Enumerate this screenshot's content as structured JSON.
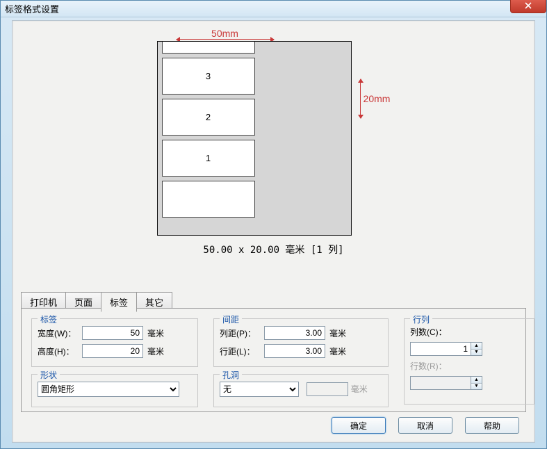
{
  "window": {
    "title": "标签格式设置"
  },
  "preview": {
    "width_dim": "50mm",
    "height_dim": "20mm",
    "labels": [
      "",
      "3",
      "2",
      "1",
      ""
    ],
    "caption": "50.00 x 20.00 毫米 [1 列]"
  },
  "tabs": {
    "printer": "打印机",
    "page": "页面",
    "label": "标签",
    "other": "其它"
  },
  "label_group": {
    "title": "标签",
    "width_label": "宽度(W)：",
    "width_value": "50",
    "width_unit": "毫米",
    "height_label": "高度(H)：",
    "height_value": "20",
    "height_unit": "毫米"
  },
  "spacing_group": {
    "title": "间距",
    "col_label": "列距(P)：",
    "col_value": "3.00",
    "col_unit": "毫米",
    "row_label": "行距(L)：",
    "row_value": "3.00",
    "row_unit": "毫米"
  },
  "rowcol_group": {
    "title": "行列",
    "cols_label": "列数(C)：",
    "cols_value": "1",
    "rows_label": "行数(R)：",
    "rows_value": ""
  },
  "shape_group": {
    "title": "形状",
    "value": "圆角矩形"
  },
  "hole_group": {
    "title": "孔洞",
    "value": "无",
    "size_value": "",
    "size_unit": "毫米"
  },
  "buttons": {
    "ok": "确定",
    "cancel": "取消",
    "help": "帮助"
  }
}
